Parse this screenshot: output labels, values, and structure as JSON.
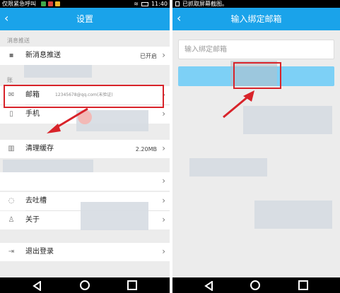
{
  "left_screen": {
    "status": {
      "carrier": "仅限紧急呼叫",
      "time": "11:40"
    },
    "title": "设置",
    "back_icon": "‹",
    "sections": {
      "notify": "消息推送",
      "account": "账",
      "redacted": ""
    },
    "rows": {
      "notify": {
        "label": "新消息推送",
        "value": "已开启"
      },
      "email": {
        "label": "邮箱",
        "value": "12345678@qq.com(未验证)"
      },
      "phone": {
        "label": "手机",
        "value": ""
      },
      "cache": {
        "label": "清理缓存",
        "value": "2.20MB"
      },
      "hidden": {
        "label": "",
        "value": ""
      },
      "feedback": {
        "label": "去吐槽",
        "value": ""
      },
      "about": {
        "label": "关于",
        "value": ""
      },
      "logout": {
        "label": "退出登录",
        "value": ""
      }
    },
    "chevron": "›"
  },
  "right_screen": {
    "status": {
      "notification": "已抓取屏幕截图。"
    },
    "title": "输入绑定邮箱",
    "back_icon": "‹",
    "email_input": {
      "value": "",
      "placeholder": "输入绑定邮箱"
    },
    "confirm_button": {
      "label": ""
    }
  },
  "colors": {
    "titlebar": "#1aa3ea",
    "highlight": "#d8232a",
    "button": "#7dd0f6"
  },
  "icons": [
    "notification-icon",
    "mail-icon",
    "phone-icon",
    "trash-icon",
    "chat-icon",
    "user-icon",
    "exit-icon",
    "chevron-right-icon",
    "back-icon"
  ]
}
